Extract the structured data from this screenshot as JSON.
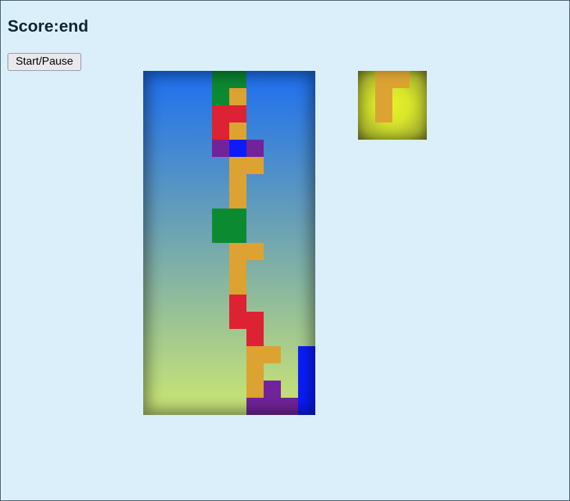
{
  "score": {
    "text": "Score:end"
  },
  "controls": {
    "start_pause_label": "Start/Pause"
  },
  "colors": {
    "green": "#0c8a32",
    "red": "#dc2233",
    "orange": "#dca332",
    "purple": "#72239a",
    "blue": "#0a1cff"
  },
  "board": {
    "cols": 10,
    "rows": 20,
    "cells": [
      [
        4,
        0,
        "green"
      ],
      [
        5,
        0,
        "green"
      ],
      [
        4,
        1,
        "green"
      ],
      [
        5,
        1,
        "orange"
      ],
      [
        4,
        2,
        "red"
      ],
      [
        5,
        2,
        "red"
      ],
      [
        4,
        3,
        "red"
      ],
      [
        5,
        3,
        "orange"
      ],
      [
        4,
        4,
        "purple"
      ],
      [
        5,
        4,
        "blue"
      ],
      [
        6,
        4,
        "purple"
      ],
      [
        5,
        5,
        "orange"
      ],
      [
        6,
        5,
        "orange"
      ],
      [
        5,
        6,
        "orange"
      ],
      [
        5,
        7,
        "orange"
      ],
      [
        4,
        8,
        "green"
      ],
      [
        5,
        8,
        "green"
      ],
      [
        4,
        9,
        "green"
      ],
      [
        5,
        9,
        "green"
      ],
      [
        5,
        10,
        "orange"
      ],
      [
        6,
        10,
        "orange"
      ],
      [
        5,
        11,
        "orange"
      ],
      [
        5,
        12,
        "orange"
      ],
      [
        5,
        13,
        "red"
      ],
      [
        5,
        14,
        "red"
      ],
      [
        6,
        14,
        "red"
      ],
      [
        6,
        15,
        "red"
      ],
      [
        6,
        16,
        "orange"
      ],
      [
        7,
        16,
        "orange"
      ],
      [
        9,
        16,
        "blue"
      ],
      [
        6,
        17,
        "orange"
      ],
      [
        9,
        17,
        "blue"
      ],
      [
        6,
        18,
        "orange"
      ],
      [
        7,
        18,
        "purple"
      ],
      [
        9,
        18,
        "blue"
      ],
      [
        6,
        19,
        "purple"
      ],
      [
        7,
        19,
        "purple"
      ],
      [
        8,
        19,
        "purple"
      ],
      [
        9,
        19,
        "blue"
      ]
    ]
  },
  "next_piece": {
    "name": "J",
    "cells": [
      [
        1,
        0,
        "orange"
      ],
      [
        2,
        0,
        "orange"
      ],
      [
        1,
        1,
        "orange"
      ],
      [
        1,
        2,
        "orange"
      ]
    ]
  }
}
